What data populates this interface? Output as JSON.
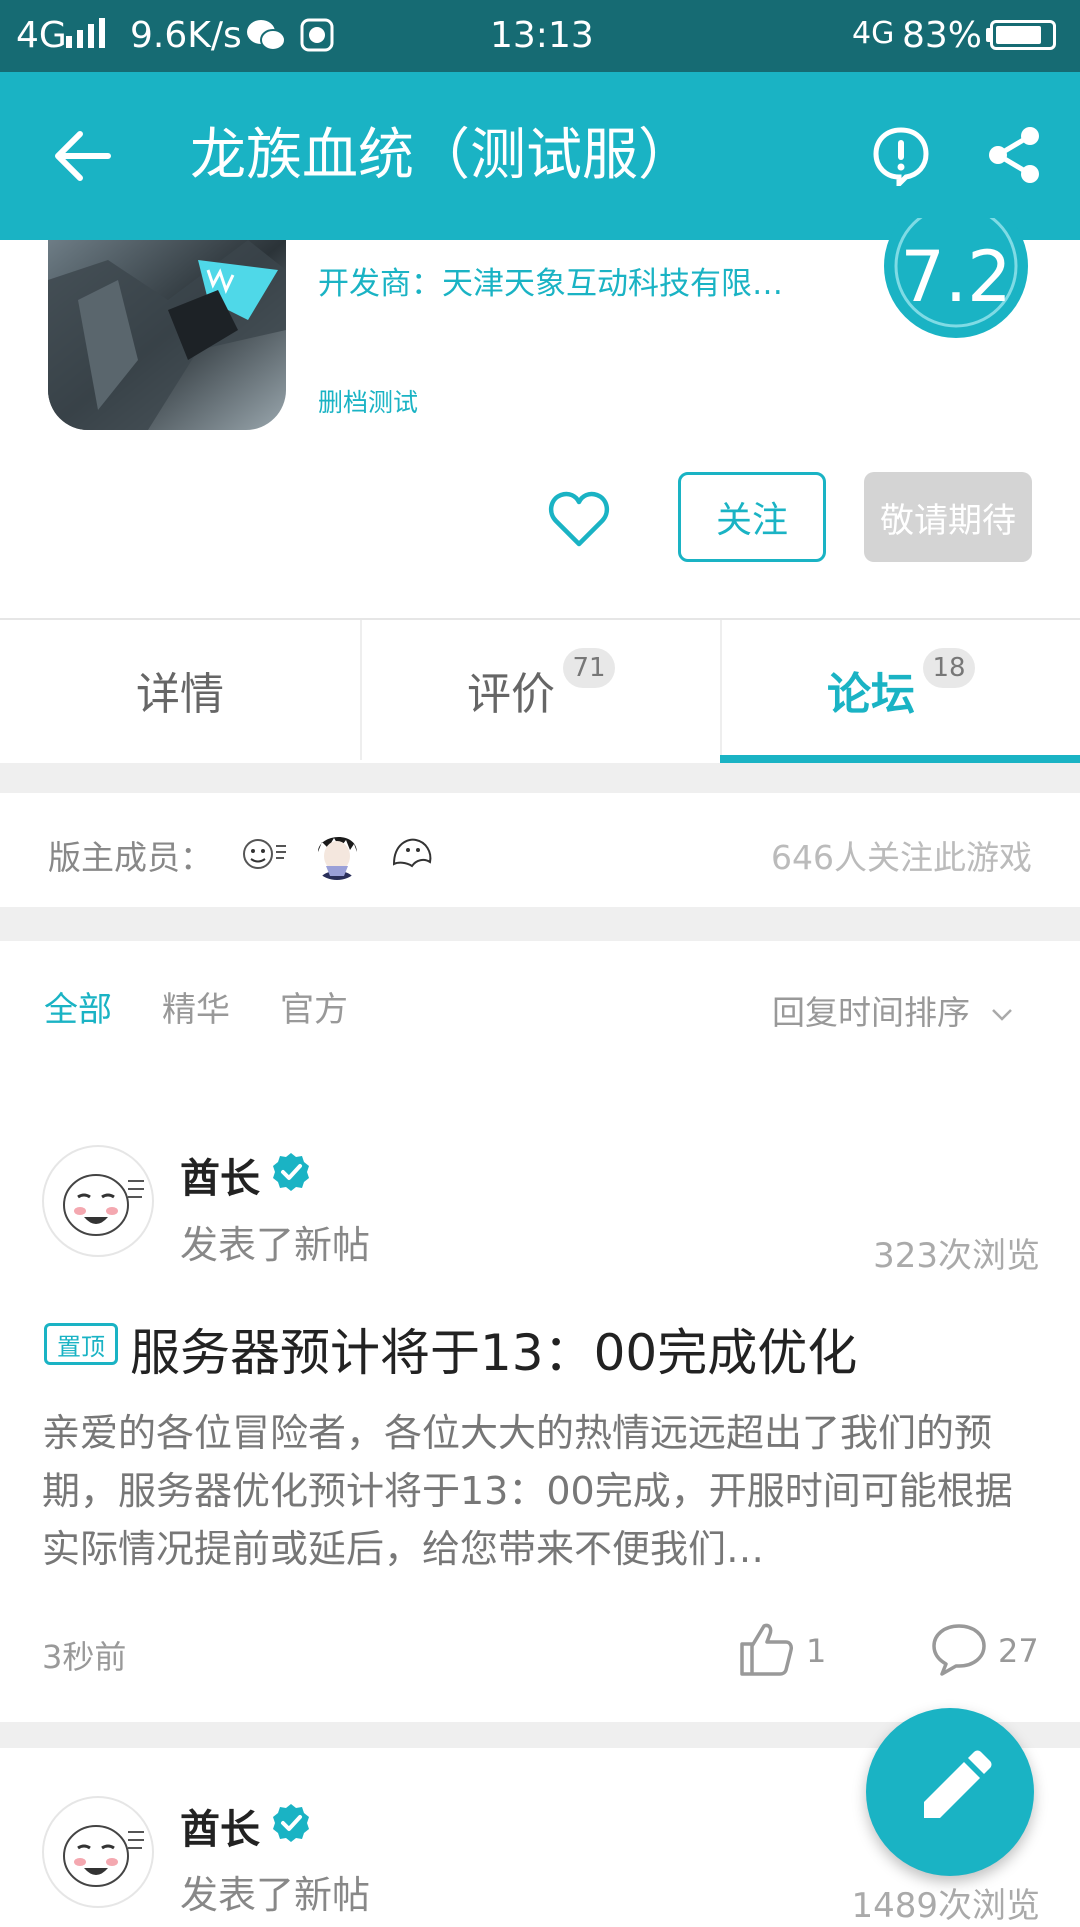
{
  "status_bar": {
    "network": "4G",
    "speed": "9.6K/s",
    "time": "13:13",
    "network_right": "4G",
    "battery": "83%",
    "battery_level": 0.83
  },
  "app_bar": {
    "title": "龙族血统（测试服）"
  },
  "game": {
    "developer": "开发商：天津天象互动科技有限…",
    "tag": "删档测试",
    "score": "7.2",
    "follow_label": "关注",
    "expect_label": "敬请期待"
  },
  "tabs": [
    {
      "label": "详情",
      "badge": ""
    },
    {
      "label": "评价",
      "badge": "71"
    },
    {
      "label": "论坛",
      "badge": "18"
    }
  ],
  "forum": {
    "moderators_label": "版主成员：",
    "followers": "646人关注此游戏",
    "filters": [
      "全部",
      "精华",
      "官方"
    ],
    "sort_label": "回复时间排序"
  },
  "posts": [
    {
      "author": "酋长",
      "action": "发表了新帖",
      "views": "323次浏览",
      "pin_label": "置顶",
      "title": "服务器预计将于13：00完成优化",
      "excerpt": "亲爱的各位冒险者，各位大大的热情远远超出了我们的预期，服务器优化预计将于13：00完成，开服时间可能根据实际情况提前或延后，给您带来不便我们…",
      "time": "3秒前",
      "likes": "1",
      "comments": "27"
    },
    {
      "author": "酋长",
      "action": "发表了新帖",
      "views": "1489次浏览"
    }
  ],
  "colors": {
    "accent": "#1ab3c4",
    "status_bar": "#166b73"
  },
  "icons": [
    "back-arrow-icon",
    "report-icon",
    "share-icon",
    "heart-icon",
    "verified-icon",
    "thumb-up-icon",
    "comment-icon",
    "edit-pencil-icon",
    "chevron-down-icon"
  ]
}
